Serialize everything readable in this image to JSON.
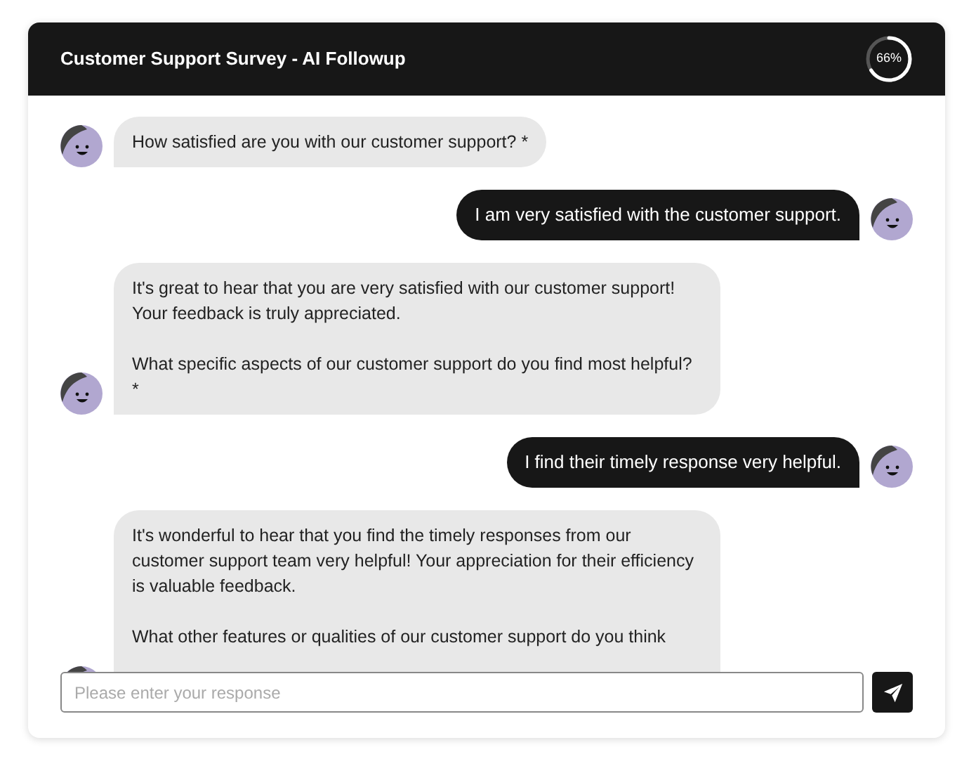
{
  "header": {
    "title": "Customer Support Survey - AI Followup",
    "progress": {
      "level": 0.66,
      "label": "66%"
    }
  },
  "messages": [
    {
      "kind": "bot",
      "paragraphs": [
        "How satisfied are you with our customer support? *"
      ]
    },
    {
      "kind": "user",
      "paragraphs": [
        "I am very satisfied with the customer support."
      ]
    },
    {
      "kind": "bot",
      "paragraphs": [
        "It's great to hear that you are very satisfied with our customer support! Your feedback is truly appreciated.",
        "What specific aspects of our customer support do you find most helpful?\n *"
      ]
    },
    {
      "kind": "user",
      "paragraphs": [
        "I find their timely response very helpful."
      ]
    },
    {
      "kind": "bot",
      "paragraphs": [
        "It's wonderful to hear that you find the timely responses from our customer support team very helpful! Your appreciation for their efficiency is valuable feedback.",
        "What other features or qualities of our customer support do you think"
      ]
    }
  ],
  "composer": {
    "placeholder": "Please enter your response"
  }
}
